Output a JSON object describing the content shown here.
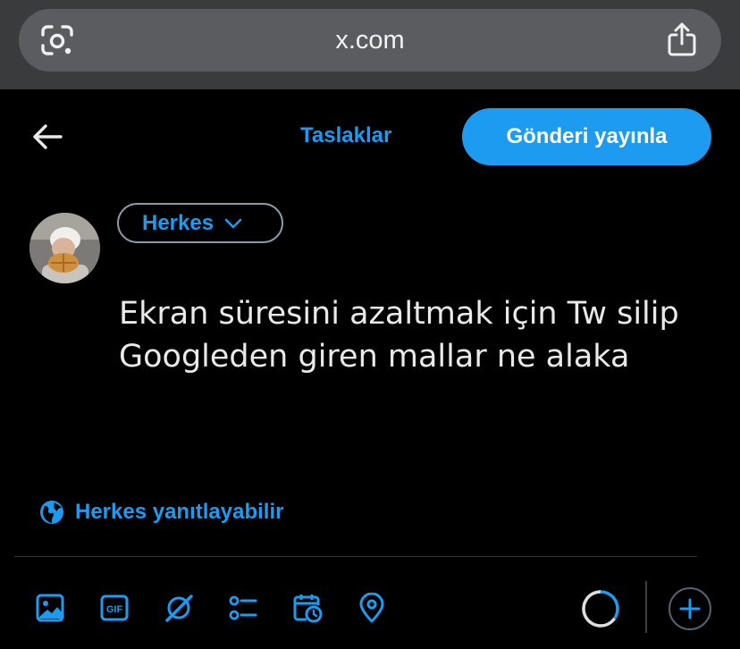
{
  "browser": {
    "url": "x.com",
    "lens_icon": "google-lens-icon",
    "share_icon": "share-icon"
  },
  "header": {
    "back_icon": "arrow-left-icon",
    "drafts_label": "Taslaklar",
    "publish_label": "Gönderi yayınla"
  },
  "composer": {
    "audience_label": "Herkes",
    "text": "Ekran süresini azaltmak için Tw silip\nGoogleden giren mallar ne alaka",
    "reply_setting_label": "Herkes yanıtlayabilir"
  },
  "toolbar": {
    "icons": [
      "image-icon",
      "gif-icon",
      "grok-icon",
      "poll-icon",
      "schedule-icon",
      "location-icon",
      "add-icon"
    ],
    "gif_label": "GIF"
  },
  "colors": {
    "accent": "#1d9bf0",
    "background": "#000000",
    "browser_bar": "#3a3b3d"
  }
}
